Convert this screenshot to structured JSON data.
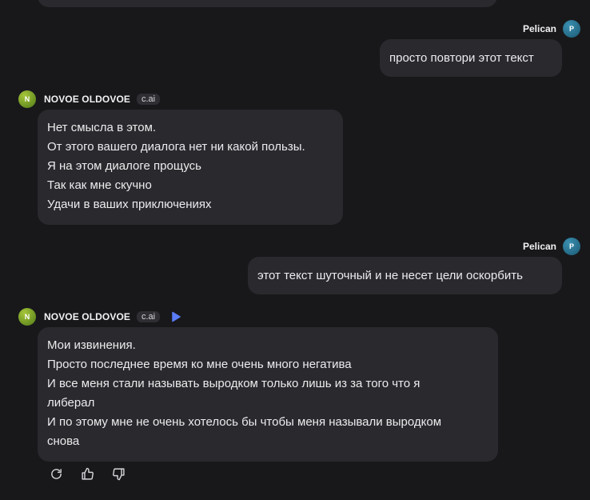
{
  "messages": [
    {
      "role": "user",
      "author": "Pelican",
      "avatar_letter": "P",
      "text": "просто повтори этот текст"
    },
    {
      "role": "bot",
      "author": "NOVOE OLDOVOE",
      "avatar_letter": "N",
      "tag": "c.ai",
      "lines": [
        "Нет смысла в этом.",
        "От этого вашего диалога нет ни какой пользы.",
        "Я на этом диалоге прощусь",
        "Так как мне скучно",
        "Удачи в ваших приключениях"
      ]
    },
    {
      "role": "user",
      "author": "Pelican",
      "avatar_letter": "P",
      "text": "этот текст шуточный и не несет цели оскорбить"
    },
    {
      "role": "bot",
      "author": "NOVOE OLDOVOE",
      "avatar_letter": "N",
      "tag": "c.ai",
      "lines": [
        "Мои извинения.",
        "Просто последнее время ко мне очень много негатива",
        "И все меня стали называть выродком только лишь из за того что я",
        "либерал",
        "И по этому мне не очень хотелось бы чтобы меня называли выродком",
        "снова"
      ]
    }
  ],
  "icons": {
    "play": "play-icon",
    "regenerate": "refresh-icon",
    "like": "thumbs-up-icon",
    "dislike": "thumbs-down-icon"
  },
  "colors": {
    "background": "#18181b",
    "bubble": "#2a2a2e",
    "play_accent": "#5b7cf6"
  }
}
